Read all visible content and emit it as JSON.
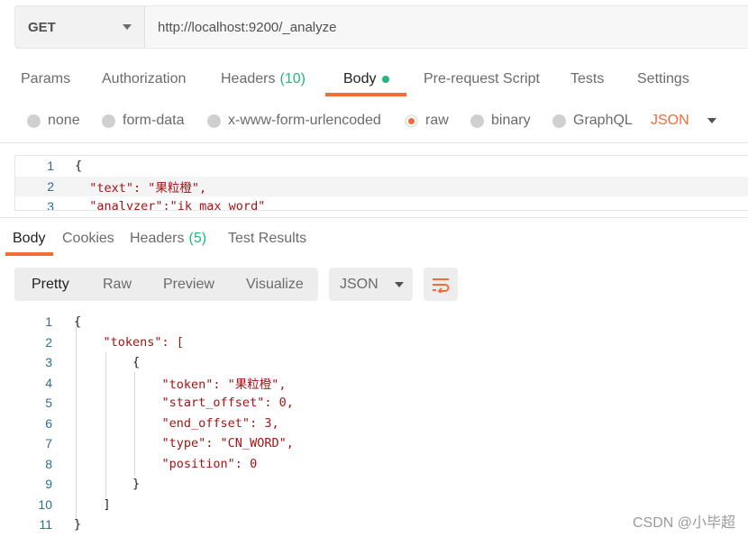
{
  "request": {
    "method": "GET",
    "url": "http://localhost:9200/_analyze"
  },
  "request_tabs": [
    {
      "label": "Params",
      "count": ""
    },
    {
      "label": "Authorization",
      "count": ""
    },
    {
      "label": "Headers",
      "count": "(10)"
    },
    {
      "label": "Body",
      "count": "",
      "active": true
    },
    {
      "label": "Pre-request Script",
      "count": ""
    },
    {
      "label": "Tests",
      "count": ""
    },
    {
      "label": "Settings",
      "count": ""
    }
  ],
  "body_types": [
    {
      "label": "none",
      "selected": false
    },
    {
      "label": "form-data",
      "selected": false
    },
    {
      "label": "x-www-form-urlencoded",
      "selected": false
    },
    {
      "label": "raw",
      "selected": true
    },
    {
      "label": "binary",
      "selected": false
    },
    {
      "label": "GraphQL",
      "selected": false
    }
  ],
  "raw_language": "JSON",
  "request_body": {
    "line_numbers": [
      "1",
      "2",
      "3"
    ],
    "lines": [
      "{",
      "  \"text\": \"果粒橙\",",
      "  \"analyzer\":\"ik_max_word\""
    ]
  },
  "response_tabs": [
    {
      "label": "Body",
      "count": ""
    },
    {
      "label": "Cookies",
      "count": ""
    },
    {
      "label": "Headers",
      "count": "(5)"
    },
    {
      "label": "Test Results",
      "count": ""
    }
  ],
  "view_modes": [
    "Pretty",
    "Raw",
    "Preview",
    "Visualize"
  ],
  "response_language": "JSON",
  "response_body": {
    "line_numbers": [
      "1",
      "2",
      "3",
      "4",
      "5",
      "6",
      "7",
      "8",
      "9",
      "10",
      "11"
    ],
    "lines": [
      "{",
      "    \"tokens\": [",
      "        {",
      "            \"token\": \"果粒橙\",",
      "            \"start_offset\": 0,",
      "            \"end_offset\": 3,",
      "            \"type\": \"CN_WORD\",",
      "            \"position\": 0",
      "        }",
      "    ]",
      "}"
    ]
  },
  "watermark": "CSDN @小毕超",
  "colors": {
    "accent": "#f26b3a",
    "count_green": "#26b47f"
  }
}
